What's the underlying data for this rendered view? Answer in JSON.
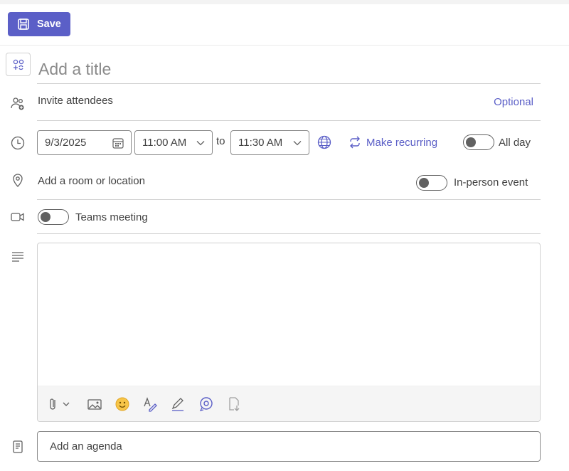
{
  "toolbar": {
    "save_label": "Save"
  },
  "event": {
    "title_placeholder": "Add a title",
    "attendees_placeholder": "Invite attendees",
    "optional_label": "Optional",
    "date": "9/3/2025",
    "start_time": "11:00 AM",
    "to_label": "to",
    "end_time": "11:30 AM",
    "make_recurring": "Make recurring",
    "all_day_label": "All day",
    "location_placeholder": "Add a room or location",
    "in_person_label": "In-person event",
    "teams_meeting_label": "Teams meeting",
    "agenda_placeholder": "Add an agenda"
  },
  "toggles": {
    "all_day": false,
    "in_person": false,
    "teams_meeting": false
  },
  "colors": {
    "accent": "#5b5fc7",
    "text": "#424242",
    "border": "#d1d1d1"
  }
}
